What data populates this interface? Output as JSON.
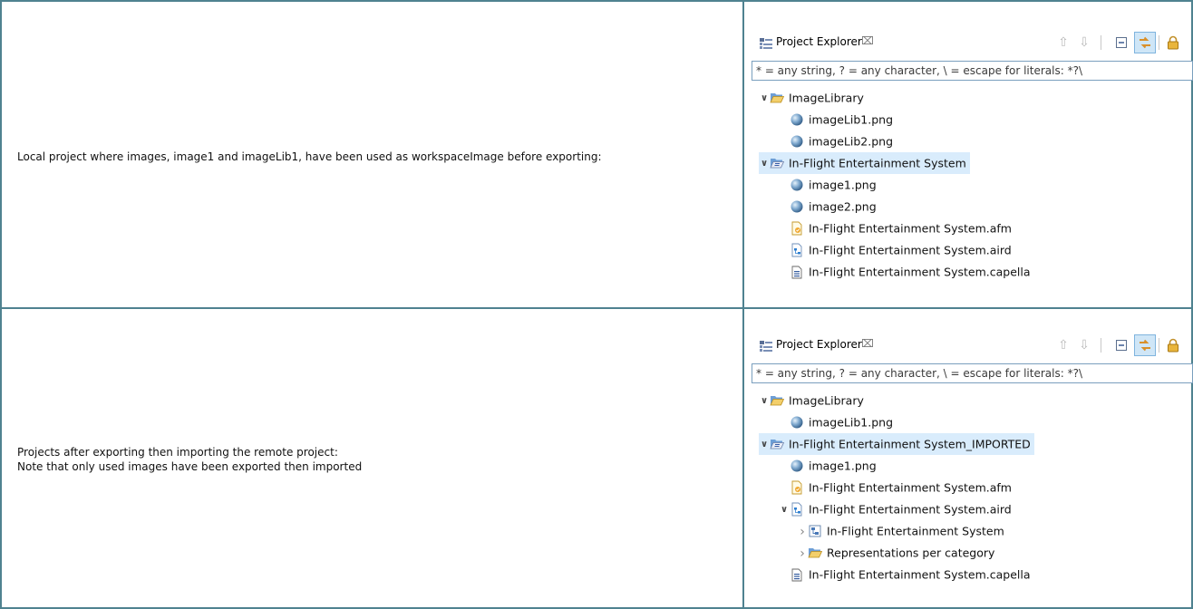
{
  "rows": [
    {
      "description": [
        "Local project where images, image1 and imageLib1, have been used as workspaceImage before exporting:"
      ],
      "explorer": {
        "title": "Project Explorer",
        "close_glyph": "⌧",
        "filter_placeholder": "* = any string, ? = any character, \\ = escape for literals: *?\\",
        "items": [
          {
            "label": "ImageLibrary",
            "icon": "folder-open-icon",
            "expander": "expanded",
            "level": 0
          },
          {
            "label": "imageLib1.png",
            "icon": "globe-image-icon",
            "expander": "none",
            "level": 1
          },
          {
            "label": "imageLib2.png",
            "icon": "globe-image-icon",
            "expander": "none",
            "level": 1
          },
          {
            "label": "In-Flight Entertainment System",
            "icon": "capella-project-icon",
            "expander": "expanded",
            "level": 0,
            "selected": true
          },
          {
            "label": "image1.png",
            "icon": "globe-image-icon",
            "expander": "none",
            "level": 1
          },
          {
            "label": "image2.png",
            "icon": "globe-image-icon",
            "expander": "none",
            "level": 1
          },
          {
            "label": "In-Flight Entertainment System.afm",
            "icon": "afm-file-icon",
            "expander": "none",
            "level": 1
          },
          {
            "label": "In-Flight Entertainment System.aird",
            "icon": "aird-file-icon",
            "expander": "none",
            "level": 1
          },
          {
            "label": "In-Flight Entertainment System.capella",
            "icon": "capella-file-icon",
            "expander": "none",
            "level": 1
          }
        ]
      }
    },
    {
      "description": [
        "Projects after exporting then importing the remote project:",
        "Note that only used images have been exported then imported"
      ],
      "explorer": {
        "title": "Project Explorer",
        "close_glyph": "⌧",
        "filter_placeholder": "* = any string, ? = any character, \\ = escape for literals: *?\\",
        "items": [
          {
            "label": "ImageLibrary",
            "icon": "folder-open-icon",
            "expander": "expanded",
            "level": 0
          },
          {
            "label": "imageLib1.png",
            "icon": "globe-image-icon",
            "expander": "none",
            "level": 1
          },
          {
            "label": "In-Flight Entertainment System_IMPORTED",
            "icon": "capella-project-icon",
            "expander": "expanded",
            "level": 0,
            "selected": true
          },
          {
            "label": "image1.png",
            "icon": "globe-image-icon",
            "expander": "none",
            "level": 1
          },
          {
            "label": "In-Flight Entertainment System.afm",
            "icon": "afm-file-icon",
            "expander": "none",
            "level": 1
          },
          {
            "label": "In-Flight Entertainment System.aird",
            "icon": "aird-file-icon",
            "expander": "expanded",
            "level": 1
          },
          {
            "label": "In-Flight Entertainment System",
            "icon": "aird-model-icon",
            "expander": "collapsed",
            "level": 2
          },
          {
            "label": "Representations per category",
            "icon": "folder-open-icon",
            "expander": "collapsed",
            "level": 2
          },
          {
            "label": "In-Flight Entertainment System.capella",
            "icon": "capella-file-icon",
            "expander": "none",
            "level": 1
          }
        ]
      }
    }
  ]
}
